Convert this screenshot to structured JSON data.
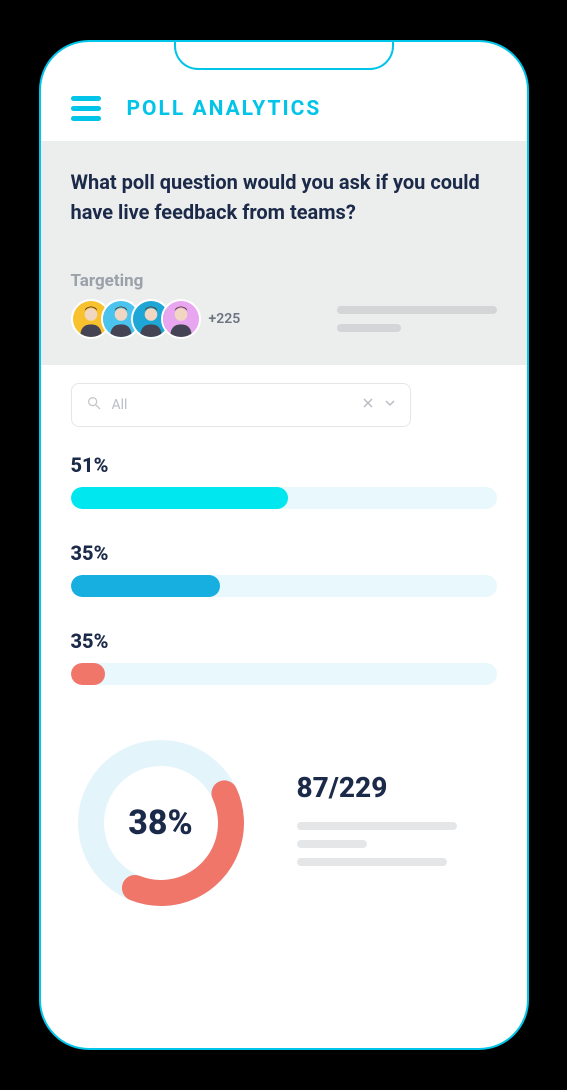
{
  "header": {
    "title": "POLL ANALYTICS"
  },
  "question": "What poll question would you ask if you could have live feedback from teams?",
  "targeting": {
    "label": "Targeting",
    "more_count": "+225",
    "avatars": [
      {
        "bg": "#f8c22e"
      },
      {
        "bg": "#4ac4ef"
      },
      {
        "bg": "#1ea7d6"
      },
      {
        "bg": "#e9a6f0"
      }
    ]
  },
  "filter": {
    "value": "All"
  },
  "chart_data": {
    "type": "bar",
    "orientation": "horizontal",
    "xlabel": "",
    "ylabel": "",
    "xlim": [
      0,
      100
    ],
    "bars": [
      {
        "label": "51%",
        "value": 51,
        "color": "#00e7f0"
      },
      {
        "label": "35%",
        "value": 35,
        "color": "#17aee0"
      },
      {
        "label": "35%",
        "value": 8,
        "color": "#f0766a",
        "display_label": "35%"
      }
    ],
    "track_color": "#e9f8fc"
  },
  "completion": {
    "percent_label": "38%",
    "percent_value": 38,
    "arc_color": "#f0766a",
    "track_color": "#e3f5fb",
    "ratio": "87/229"
  }
}
